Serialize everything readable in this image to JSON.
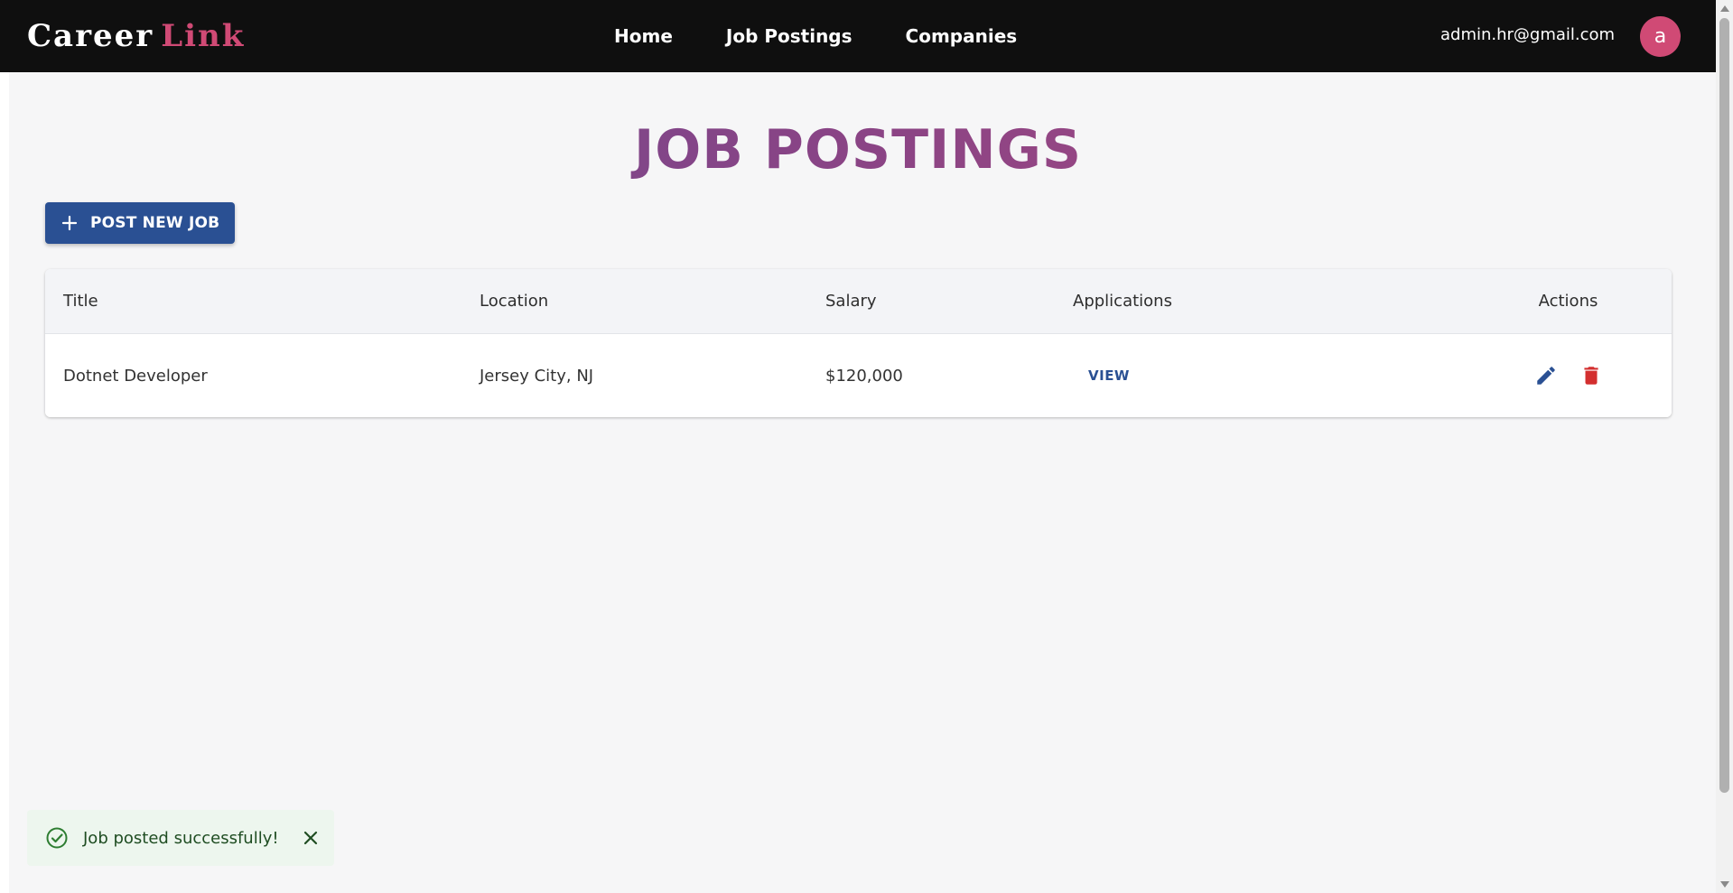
{
  "navbar": {
    "brand_part1": "Career",
    "brand_part2": "Link",
    "links": [
      "Home",
      "Job Postings",
      "Companies"
    ],
    "user_email": "admin.hr@gmail.com",
    "avatar_letter": "a"
  },
  "page": {
    "title": "JOB POSTINGS",
    "post_button_label": "POST NEW JOB",
    "post_button_icon": "plus-icon"
  },
  "table": {
    "headers": [
      "Title",
      "Location",
      "Salary",
      "Applications",
      "Actions"
    ],
    "rows": [
      {
        "title": "Dotnet Developer",
        "location": "Jersey City, NJ",
        "salary": "$120,000",
        "applications_link": "VIEW",
        "actions": [
          "edit-icon",
          "delete-icon"
        ]
      }
    ]
  },
  "toast": {
    "message": "Job posted successfully!",
    "icon": "check-circle-icon",
    "close_icon": "close-icon"
  },
  "colors": {
    "navbar_bg": "#0f0f0f",
    "brand_accent": "#d04a75",
    "primary_blue": "#2a5093",
    "delete_red": "#d32f2f",
    "toast_bg": "#edf6ee",
    "title_gradient_start": "#6a4a92",
    "title_gradient_end": "#b04b7f"
  }
}
